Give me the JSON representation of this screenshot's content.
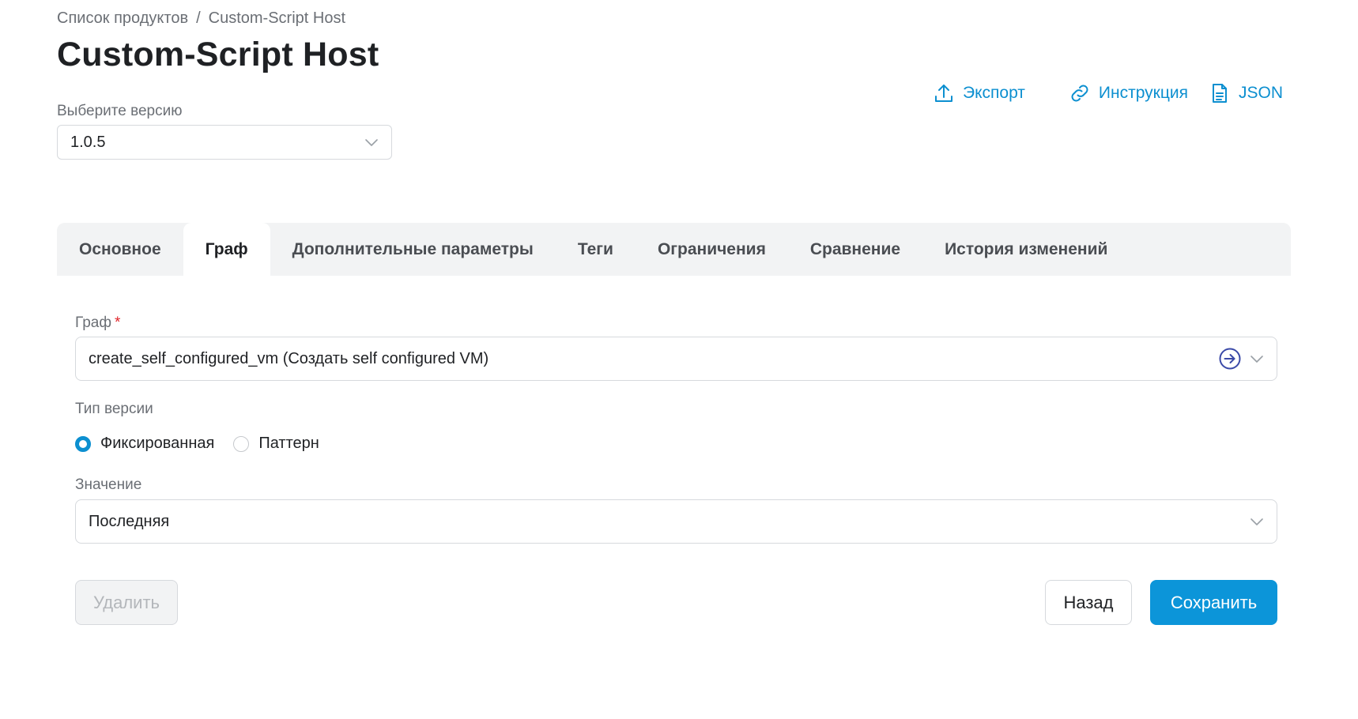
{
  "breadcrumb": {
    "parent": "Список продуктов",
    "separator": "/",
    "current": "Custom-Script Host"
  },
  "page": {
    "title": "Custom-Script Host"
  },
  "actions": {
    "export_label": "Экспорт",
    "instruction_label": "Инструкция",
    "json_label": "JSON"
  },
  "version": {
    "label": "Выберите версию",
    "value": "1.0.5"
  },
  "tabs": [
    {
      "label": "Основное"
    },
    {
      "label": "Граф"
    },
    {
      "label": "Дополнительные параметры"
    },
    {
      "label": "Теги"
    },
    {
      "label": "Ограничения"
    },
    {
      "label": "Сравнение"
    },
    {
      "label": "История изменений"
    }
  ],
  "active_tab_index": 1,
  "form": {
    "graph_label": "Граф",
    "graph_required_mark": "*",
    "graph_value": "create_self_configured_vm (Создать self configured VM)",
    "version_type_label": "Тип версии",
    "radio_fixed_label": "Фиксированная",
    "radio_pattern_label": "Паттерн",
    "selected_version_type": "Фиксированная",
    "value_label": "Значение",
    "value_value": "Последняя"
  },
  "buttons": {
    "delete_label": "Удалить",
    "back_label": "Назад",
    "save_label": "Сохранить"
  },
  "colors": {
    "accent": "#0c8fd0",
    "primary_button": "#0c95d9",
    "required": "#e0262b",
    "tabs_background": "#f2f3f4"
  },
  "icons": {
    "export": "upload-icon",
    "instruction": "link-icon",
    "json": "document-icon",
    "dropdown": "chevron-down-icon",
    "graph_open": "arrow-circle-right-icon"
  }
}
